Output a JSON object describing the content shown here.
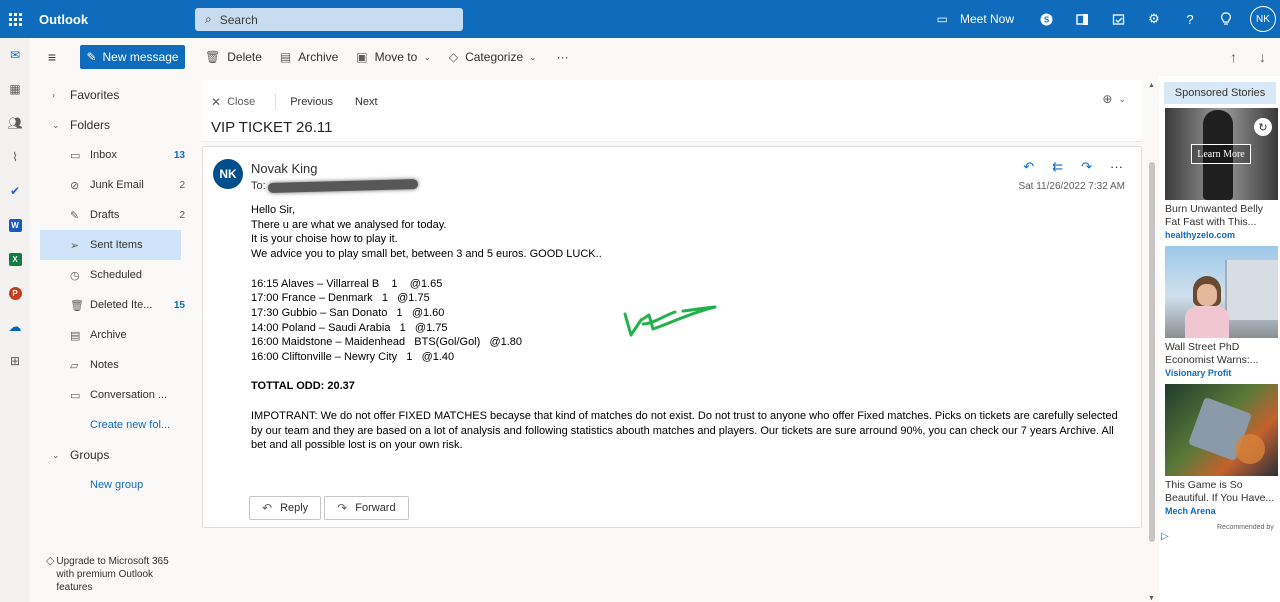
{
  "app": {
    "title": "Outlook"
  },
  "search": {
    "placeholder": "Search"
  },
  "topbar": {
    "meet_now": "Meet Now",
    "avatar_initials": "NK"
  },
  "commands": {
    "new_message": "New message",
    "delete": "Delete",
    "archive": "Archive",
    "move_to": "Move to",
    "categorize": "Categorize",
    "more": "···"
  },
  "folders": {
    "favorites": "Favorites",
    "folders": "Folders",
    "items": [
      {
        "label": "Inbox",
        "count": "13",
        "icon": "inbox-icon"
      },
      {
        "label": "Junk Email",
        "count": "2",
        "icon": "junk-icon"
      },
      {
        "label": "Drafts",
        "count": "2",
        "icon": "drafts-icon"
      },
      {
        "label": "Sent Items",
        "count": "",
        "icon": "sent-icon"
      },
      {
        "label": "Scheduled",
        "count": "",
        "icon": "clock-icon"
      },
      {
        "label": "Deleted Ite...",
        "count": "15",
        "icon": "trash-icon"
      },
      {
        "label": "Archive",
        "count": "",
        "icon": "archive-icon"
      },
      {
        "label": "Notes",
        "count": "",
        "icon": "notes-icon"
      },
      {
        "label": "Conversation ...",
        "count": "",
        "icon": "folder-icon"
      }
    ],
    "create_new": "Create new fol...",
    "groups": "Groups",
    "new_group": "New group",
    "upgrade": "Upgrade to Microsoft 365 with premium Outlook features"
  },
  "reading": {
    "close": "Close",
    "previous": "Previous",
    "next": "Next",
    "subject": "VIP TICKET 26.11"
  },
  "message": {
    "avatar": "NK",
    "sender": "Novak King",
    "to_label": "To:",
    "date": "Sat 11/26/2022 7:32 AM",
    "body": {
      "greeting": "Hello Sir,",
      "line1": "There u are what we analysed for today.",
      "line2": "It is your choise how to play it.",
      "line3": "We advice you to play small bet, between 3 and 5 euros. GOOD LUCK..",
      "picks": [
        "16:15 Alaves – Villarreal B    1    @1.65",
        "17:00 France – Denmark   1   @1.75",
        "17:30 Gubbio – San Donato   1   @1.60",
        "14:00 Poland – Saudi Arabia   1   @1.75",
        "16:00 Maidstone – Maidenhead   BTS(Gol/Gol)   @1.80",
        "16:00 Cliftonville – Newry City   1   @1.40"
      ],
      "total": "TOTTAL ODD: 20.37",
      "disclaimer": "IMPOTRANT: We do not offer FIXED MATCHES becayse that kind of matches do not exist. Do not trust to anyone who offer Fixed matches. Picks on tickets are carefully selected by our team and they are based on a lot of analysis and following statistics abouth matches and players. Our tickets are sure arround 90%, you can check our 7 years Archive. All bet and all possible lost is on your own risk."
    },
    "reply": "Reply",
    "forward": "Forward"
  },
  "ads": {
    "header": "Sponsored Stories",
    "learn_more": "Learn More",
    "items": [
      {
        "title": "Burn Unwanted Belly Fat Fast with This...",
        "source": "healthyzelo.com"
      },
      {
        "title": "Wall Street PhD Economist Warns:...",
        "source": "Visionary Profit"
      },
      {
        "title": "This Game is So Beautiful. If You Have...",
        "source": "Mech Arena"
      }
    ],
    "recommended": "Recommended by"
  }
}
